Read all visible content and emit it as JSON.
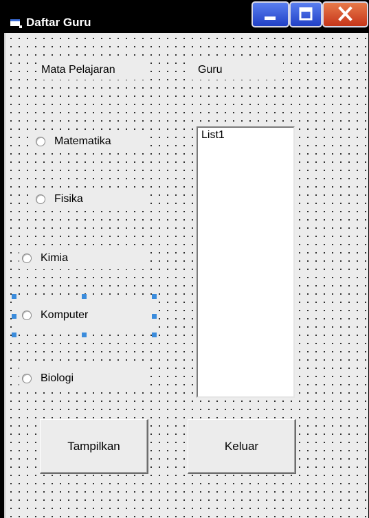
{
  "window": {
    "title": "Daftar Guru"
  },
  "labels": {
    "subject": "Mata Pelajaran",
    "teacher": "Guru"
  },
  "radios": [
    "Matematika",
    "Fisika",
    "Kimia",
    "Komputer",
    "Biologi"
  ],
  "list": {
    "items": [
      "List1"
    ]
  },
  "buttons": {
    "show": "Tampilkan",
    "exit": "Keluar"
  }
}
